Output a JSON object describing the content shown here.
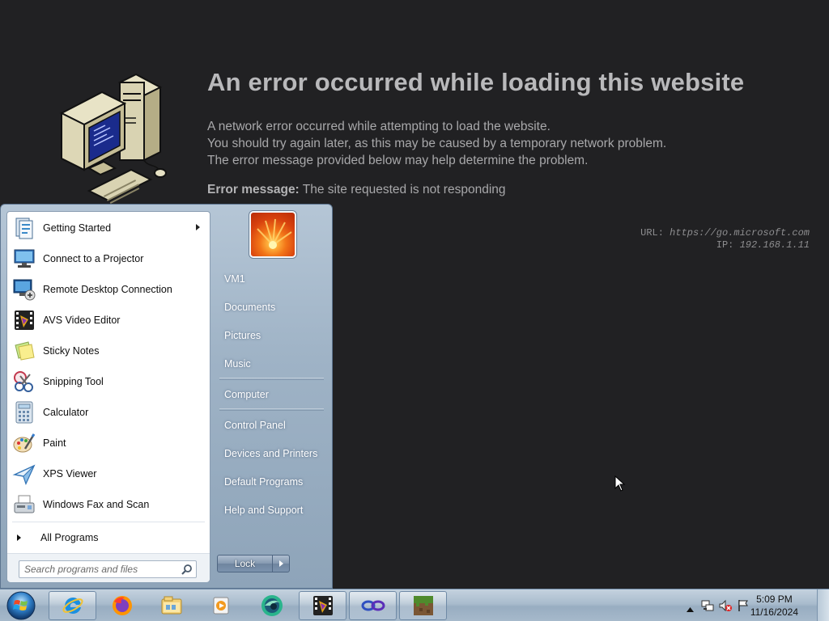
{
  "error_page": {
    "title": "An error occurred while loading this website",
    "lines": [
      "A network error occurred while attempting to load the website.",
      "You should try again later, as this may be caused by a temporary network problem.",
      "The error message provided below may help determine the problem."
    ],
    "error_label": "Error message:",
    "error_text": " The site requested is not responding",
    "url_label": "URL: ",
    "url_value": "https://go.microsoft.com",
    "ip_label": "IP: ",
    "ip_value": "192.168.1.11"
  },
  "start_menu": {
    "programs": [
      {
        "label": "Getting Started",
        "icon": "getting-started-icon",
        "has_submenu": true
      },
      {
        "label": "Connect to a Projector",
        "icon": "projector-icon"
      },
      {
        "label": "Remote Desktop Connection",
        "icon": "remote-desktop-icon"
      },
      {
        "label": "AVS Video Editor",
        "icon": "video-editor-icon"
      },
      {
        "label": "Sticky Notes",
        "icon": "sticky-notes-icon"
      },
      {
        "label": "Snipping Tool",
        "icon": "snipping-tool-icon"
      },
      {
        "label": "Calculator",
        "icon": "calculator-icon"
      },
      {
        "label": "Paint",
        "icon": "paint-icon"
      },
      {
        "label": "XPS Viewer",
        "icon": "xps-viewer-icon"
      },
      {
        "label": "Windows Fax and Scan",
        "icon": "fax-scan-icon"
      }
    ],
    "all_programs": "All Programs",
    "search_placeholder": "Search programs and files",
    "right_items": {
      "user": "VM1",
      "documents": "Documents",
      "pictures": "Pictures",
      "music": "Music",
      "computer": "Computer",
      "control_panel": "Control Panel",
      "devices": "Devices and Printers",
      "default_programs": "Default Programs",
      "help": "Help and Support"
    },
    "lock_label": "Lock"
  },
  "taskbar": {
    "apps": [
      "internet-explorer-icon",
      "firefox-icon",
      "file-explorer-icon",
      "media-player-icon",
      "browser-app-icon",
      "video-editor-icon",
      "link-app-icon",
      "minecraft-icon"
    ],
    "time": "5:09 PM",
    "date": "11/16/2024"
  }
}
